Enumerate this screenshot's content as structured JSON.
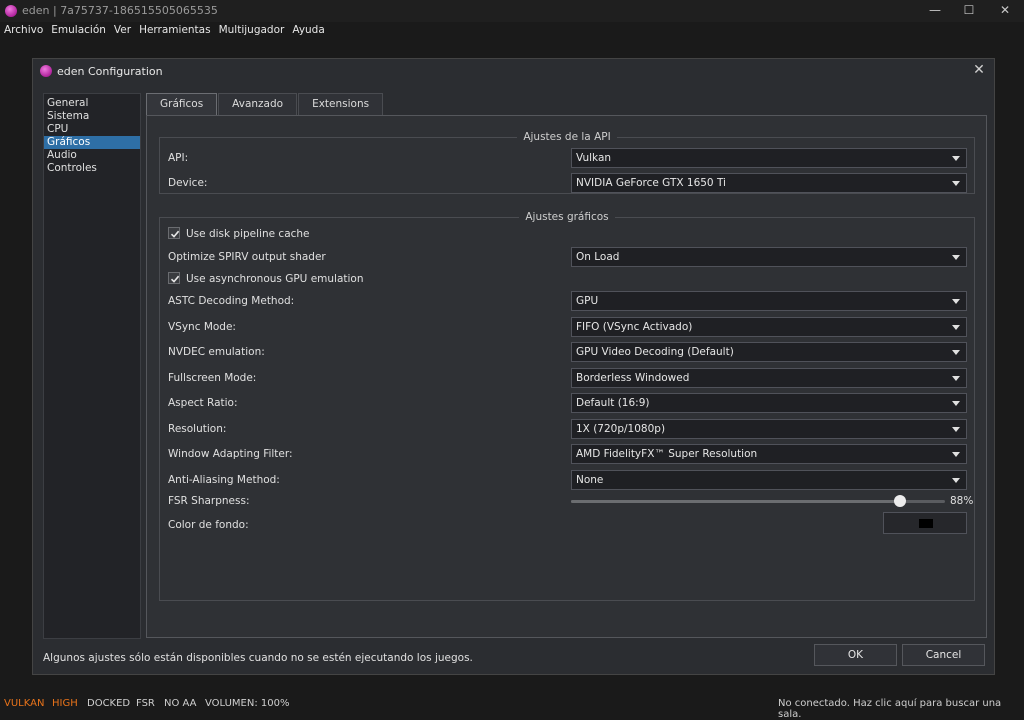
{
  "window": {
    "title": "eden | 7a75737-1865155050655​35",
    "minimize": "—",
    "maximize": "☐",
    "close": "✕"
  },
  "menu": [
    "Archivo",
    "Emulación",
    "Ver",
    "Herramientas",
    "Multijugador",
    "Ayuda"
  ],
  "dialog": {
    "title": "eden Configuration",
    "close": "✕",
    "sidebar": [
      "General",
      "Sistema",
      "CPU",
      "Gráficos",
      "Audio",
      "Controles"
    ],
    "sidebar_selected": "Gráficos",
    "tabs": [
      "Gráficos",
      "Avanzado",
      "Extensions"
    ],
    "api_group": {
      "title": "Ajustes de la API",
      "api_label": "API:",
      "api_value": "Vulkan",
      "device_label": "Device:",
      "device_value": "NVIDIA GeForce GTX 1650 Ti"
    },
    "graphics_group": {
      "title": "Ajustes gráficos",
      "disk_cache_label": "Use disk pipeline cache",
      "disk_cache_checked": true,
      "spirv_label": "Optimize SPIRV output shader",
      "spirv_value": "On Load",
      "async_gpu_label": "Use asynchronous GPU emulation",
      "async_gpu_checked": true,
      "astc_label": "ASTC Decoding Method:",
      "astc_value": "GPU",
      "vsync_label": "VSync Mode:",
      "vsync_value": "FIFO (VSync Activado)",
      "nvdec_label": "NVDEC emulation:",
      "nvdec_value": "GPU Video Decoding (Default)",
      "fullscreen_label": "Fullscreen Mode:",
      "fullscreen_value": "Borderless Windowed",
      "aspect_label": "Aspect Ratio:",
      "aspect_value": "Default (16:9)",
      "resolution_label": "Resolution:",
      "resolution_value": "1X (720p/1080p)",
      "filter_label": "Window Adapting Filter:",
      "filter_value": "AMD FidelityFX™ Super Resolution",
      "aa_label": "Anti-Aliasing Method:",
      "aa_value": "None",
      "fsr_label": "FSR Sharpness:",
      "fsr_value": "88%",
      "fsr_fraction": 0.88,
      "bg_color_label": "Color de fondo:",
      "bg_color": "#000000"
    },
    "footer_note": "Algunos ajustes sólo están disponibles cuando no se estén ejecutando los juegos.",
    "ok_label": "OK",
    "cancel_label": "Cancel"
  },
  "statusbar": {
    "items": [
      "VULKAN",
      "HIGH",
      "DOCKED",
      "FSR",
      "NO AA",
      "VOLUMEN: 100%"
    ],
    "highlight_color": "#e8731a",
    "network": "No conectado. Haz clic aquí para buscar una sala."
  }
}
